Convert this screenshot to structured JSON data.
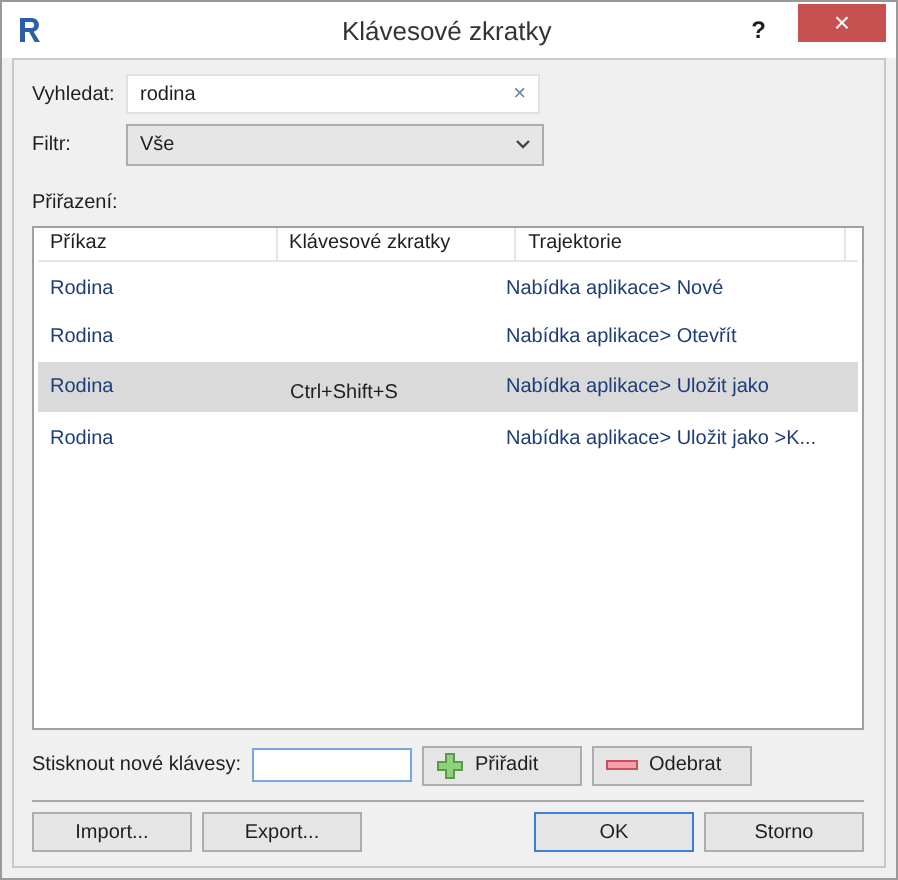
{
  "window": {
    "title": "Klávesové zkratky",
    "help": "?",
    "close": "×"
  },
  "search": {
    "label": "Vyhledat:",
    "value": "rodina",
    "clear": "×"
  },
  "filter": {
    "label": "Filtr:",
    "value": "Vše"
  },
  "assignments_label": "Přiřazení:",
  "table": {
    "columns": [
      "Příkaz",
      "Klávesové zkratky",
      "Trajektorie"
    ],
    "rows": [
      {
        "command": "Rodina",
        "shortcut": "",
        "path": "Nabídka aplikace> Nové",
        "selected": false
      },
      {
        "command": "Rodina",
        "shortcut": "",
        "path": "Nabídka aplikace> Otevřít",
        "selected": false
      },
      {
        "command": "Rodina",
        "shortcut": "Ctrl+Shift+S",
        "path": "Nabídka aplikace> Uložit jako",
        "selected": true
      },
      {
        "command": "Rodina",
        "shortcut": "",
        "path": "Nabídka aplikace> Uložit jako >K...",
        "selected": false
      }
    ]
  },
  "new_keys": {
    "label": "Stisknout nové klávesy:"
  },
  "assign_button": "Přiřadit",
  "remove_button": "Odebrat",
  "buttons": [
    {
      "label": "Import...",
      "kind": "plain"
    },
    {
      "label": "Export...",
      "kind": "plain"
    },
    {
      "label": "OK",
      "kind": "default"
    },
    {
      "label": "Storno",
      "kind": "plain"
    }
  ]
}
